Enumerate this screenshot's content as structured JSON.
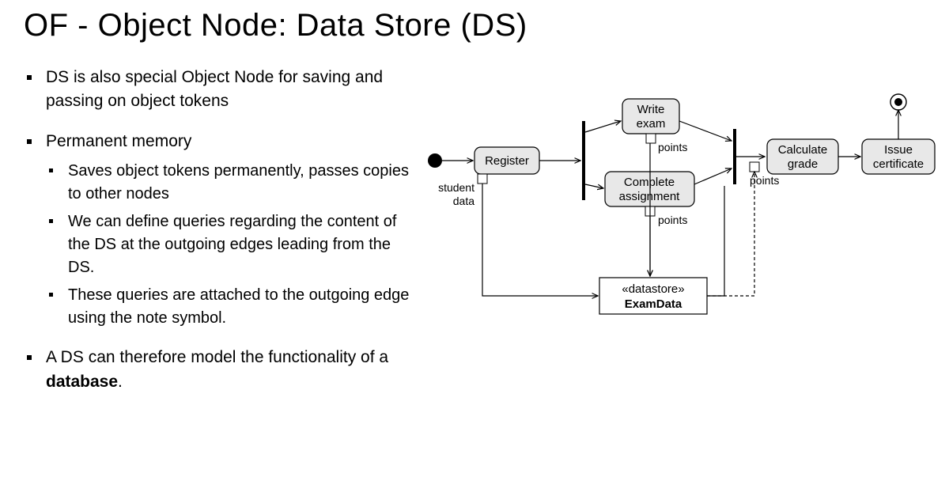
{
  "title": "OF - Object Node: Data Store (DS)",
  "bullets": {
    "b1": "DS is also special Object Node for saving and passing on object tokens",
    "b2": "Permanent memory",
    "b2s1": "Saves object tokens permanently, passes copies to other nodes",
    "b2s2": "We can define queries regarding the content of the DS at the outgoing edges leading from the DS.",
    "b2s3": "These queries are attached to the outgoing edge using the note symbol.",
    "b3a": "A DS can therefore model the functionality of a ",
    "b3b": "database",
    "b3c": "."
  },
  "diagram": {
    "register": "Register",
    "register_pin": "student data",
    "write_exam_l1": "Write",
    "write_exam_l2": "exam",
    "complete_l1": "Complete",
    "complete_l2": "assignment",
    "points": "points",
    "calc_l1": "Calculate",
    "calc_l2": "grade",
    "issue_l1": "Issue",
    "issue_l2": "certificate",
    "ds_stereo": "«datastore»",
    "ds_name": "ExamData"
  }
}
